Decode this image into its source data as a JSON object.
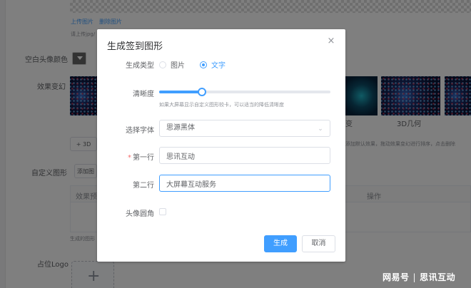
{
  "background": {
    "upload_links": {
      "upload": "上传图片",
      "delete": "删除图片"
    },
    "upload_hint": "请上传jpg/",
    "blank_avatar_color_label": "空白头像颜色",
    "effect_label": "效果变幻",
    "effect_captions": {
      "partial": "变",
      "geometry": "3D几何"
    },
    "add_3d_button": "+ 3D",
    "effect_hint": "添加默认效果，拖动效果变幻进行排序，点击删除",
    "custom_shape_label": "自定义图形",
    "add_shape_button": "添加图",
    "table_headers": {
      "preview": "效果预",
      "actions": "操作"
    },
    "generated_hint": "生成的图形",
    "logo_label": "占位Logo",
    "upload_plus": "+"
  },
  "dialog": {
    "title": "生成签到图形",
    "close_icon": "×",
    "type": {
      "label": "生成类型",
      "options": [
        {
          "label": "图片",
          "selected": false
        },
        {
          "label": "文字",
          "selected": true
        }
      ]
    },
    "clarity": {
      "label": "清晰度",
      "value": 0.25,
      "hint": "如果大屏幕显示自定义图形较卡，可以适当的降低清晰度"
    },
    "font": {
      "label": "选择字体",
      "value": "思源黑体",
      "arrow_icon": "chevron-down"
    },
    "line1": {
      "label": "第一行",
      "required_mark": "*",
      "value": "思讯互动"
    },
    "line2": {
      "label": "第二行",
      "value": "大屏幕互动服务"
    },
    "rounded": {
      "label": "头像圆角",
      "checked": false
    },
    "buttons": {
      "generate": "生成",
      "cancel": "取消"
    }
  },
  "watermark": {
    "brand": "网易号",
    "author": "思讯互动",
    "separator": "|"
  },
  "colors": {
    "primary": "#409eff",
    "overlay": "rgba(0,0,0,0.5)"
  }
}
